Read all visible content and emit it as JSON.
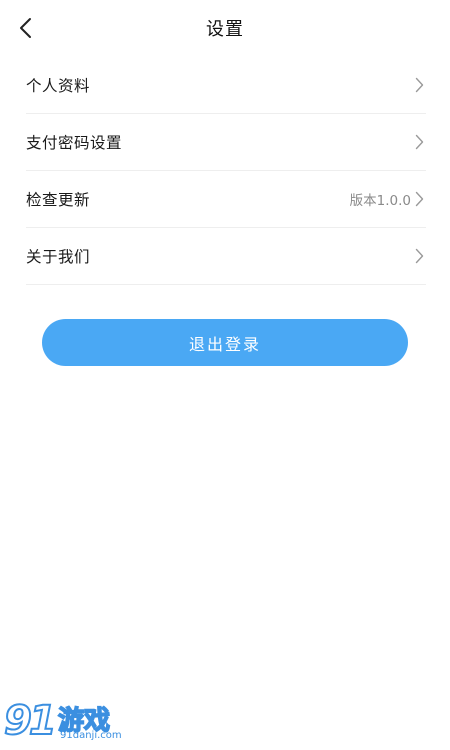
{
  "header": {
    "title": "设置",
    "back_icon": "chevron-left-icon"
  },
  "menu": {
    "items": [
      {
        "label": "个人资料",
        "value": ""
      },
      {
        "label": "支付密码设置",
        "value": ""
      },
      {
        "label": "检查更新",
        "value": "版本1.0.0"
      },
      {
        "label": "关于我们",
        "value": ""
      }
    ]
  },
  "logout": {
    "label": "退出登录"
  },
  "watermark": {
    "logo_text": "91游戏",
    "url": "91danji.com"
  },
  "colors": {
    "accent": "#4aa8f4",
    "divider": "#eeeeee",
    "muted_text": "#8a8a8a"
  }
}
